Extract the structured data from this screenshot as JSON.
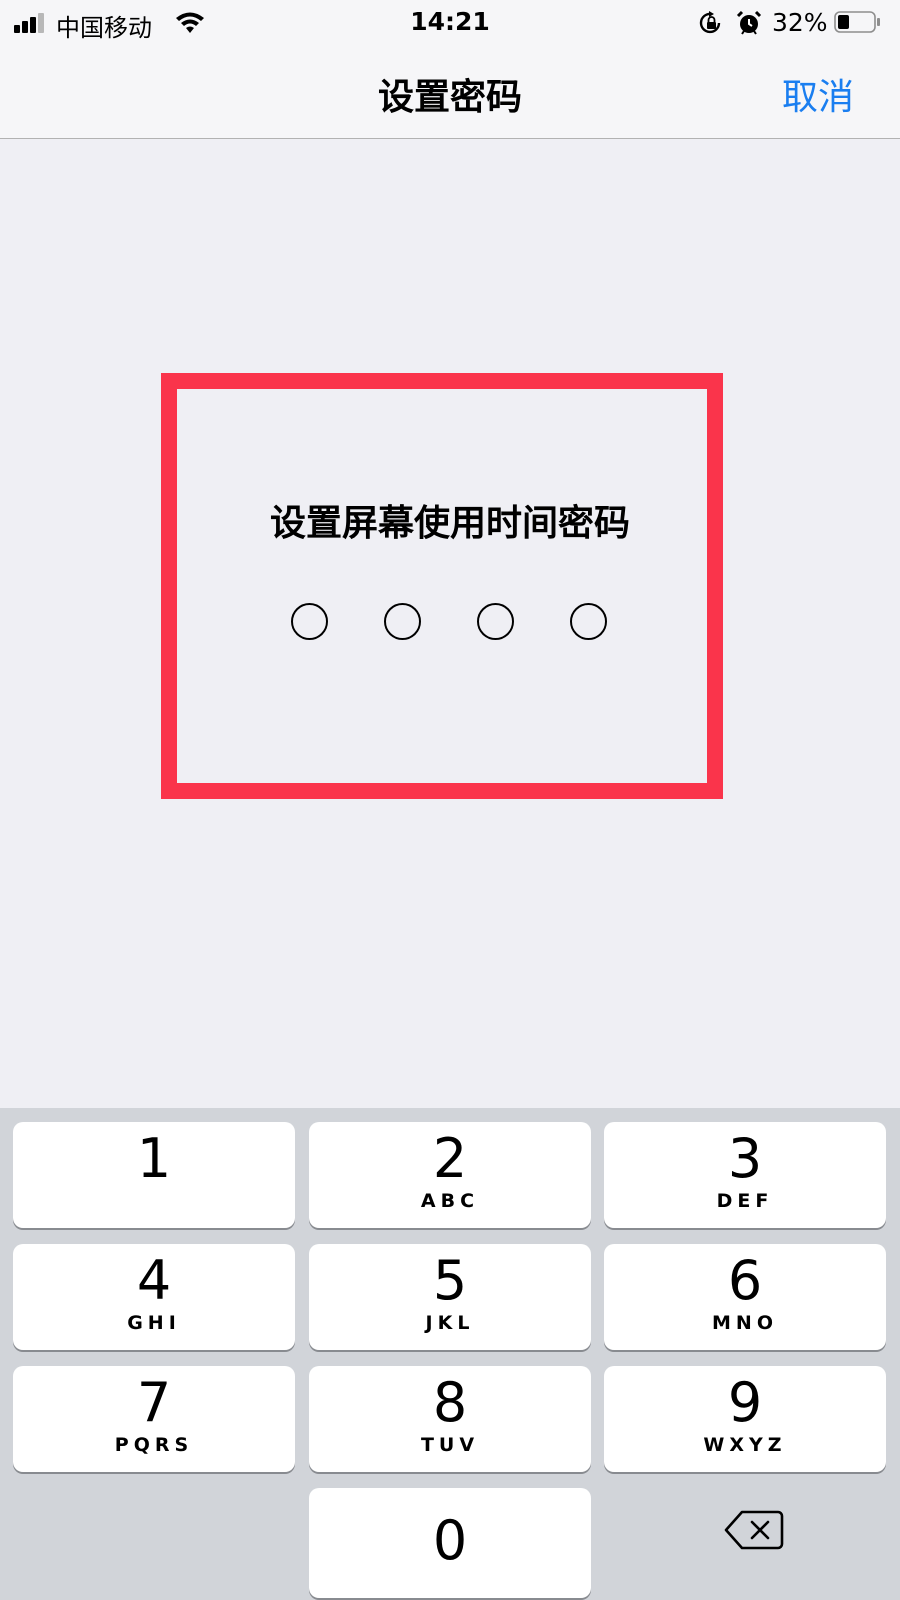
{
  "status_bar": {
    "carrier": "中国移动",
    "time": "14:21",
    "battery_percent": "32%",
    "battery_level": 0.32,
    "icons": [
      "signal-icon",
      "wifi-icon",
      "rotation-lock-icon",
      "alarm-icon",
      "battery-icon"
    ]
  },
  "nav": {
    "title": "设置密码",
    "cancel_label": "取消"
  },
  "passcode": {
    "prompt": "设置屏幕使用时间密码",
    "digits_total": 4,
    "digits_entered": 0
  },
  "keypad": {
    "keys": [
      {
        "number": "1",
        "letters": ""
      },
      {
        "number": "2",
        "letters": "ABC"
      },
      {
        "number": "3",
        "letters": "DEF"
      },
      {
        "number": "4",
        "letters": "GHI"
      },
      {
        "number": "5",
        "letters": "JKL"
      },
      {
        "number": "6",
        "letters": "MNO"
      },
      {
        "number": "7",
        "letters": "PQRS"
      },
      {
        "number": "8",
        "letters": "TUV"
      },
      {
        "number": "9",
        "letters": "WXYZ"
      },
      {
        "number": "0",
        "letters": ""
      }
    ],
    "delete_icon": "delete-icon"
  },
  "colors": {
    "accent": "#1a7ef0",
    "highlight": "#fa344b",
    "background": "#efeff4",
    "keypad_background": "#d1d4d9"
  }
}
